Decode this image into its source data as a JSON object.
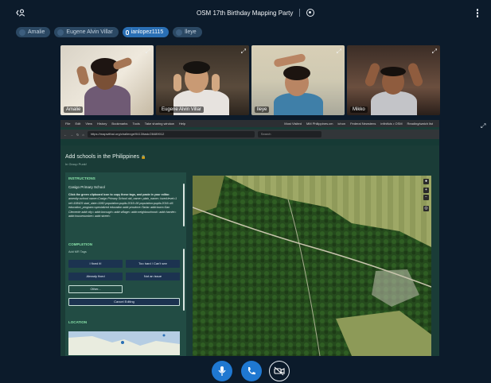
{
  "window": {
    "title": "OSM 17th Birthday Mapping Party"
  },
  "participants": [
    {
      "name": "Amalie",
      "active": false
    },
    {
      "name": "Eugene Alvin Villar",
      "active": false
    },
    {
      "name": "ianlopez1115",
      "active": true
    },
    {
      "name": "lleye",
      "active": false
    }
  ],
  "video_tiles": [
    {
      "name": "Amalie"
    },
    {
      "name": "Eugene Alvin Villar"
    },
    {
      "name": "lleye"
    },
    {
      "name": "Mikko"
    }
  ],
  "share": {
    "browser_menu": [
      "File",
      "Edit",
      "View",
      "History",
      "Bookmarks",
      "Tools",
      "Take sharing window",
      "Help"
    ],
    "bookmarks": [
      "Most Visited",
      "MM Philippines.cm",
      "ichon",
      "Federal Newstens",
      "infinifuls • OSM",
      "Reading/watch list"
    ],
    "url": "https://mapwithai.org/challenge/9413/task/28489012",
    "search_placeholder": "Search",
    "task_title": "Add schools in the Philippines",
    "task_sub": "In Group Punk!",
    "instructions": {
      "header": "INSTRUCTIONS",
      "school": "Casigo Primary School",
      "body_lead": "Click the green clipboard icon to copy these tags, and paste in your editor.",
      "body_tags": "amenity=school name=Casigo Primary School old_name= plain_name= isced:level=1 ref=108425 start_date=1950 population:pupils:2015=36 population:pupils:2016=46 education_program=specialized education addr:province=Tarlac addr:town=San Clemente addr:city= addr:borough= addr:village= addr:neighbourhood= addr:hamlet= addr:housenumber= addr:street="
    },
    "completion": {
      "header": "COMPLETION",
      "sub": "Add MR Tags",
      "buttons": [
        "I fixed it!",
        "Too hard / Can't see",
        "Already fixed",
        "Not an issue",
        "Other...",
        "Cancel Editing"
      ]
    },
    "location": {
      "header": "LOCATION"
    }
  },
  "controls": {
    "mic": "microphone",
    "hangup": "phone",
    "video": "video-camera"
  },
  "colors": {
    "background": "#0c1b2b",
    "chip": "#2b4863",
    "chip_active": "#2a6fb4",
    "accent": "#1f78d1",
    "panel": "#224c44",
    "heading_green": "#88e0a8"
  }
}
